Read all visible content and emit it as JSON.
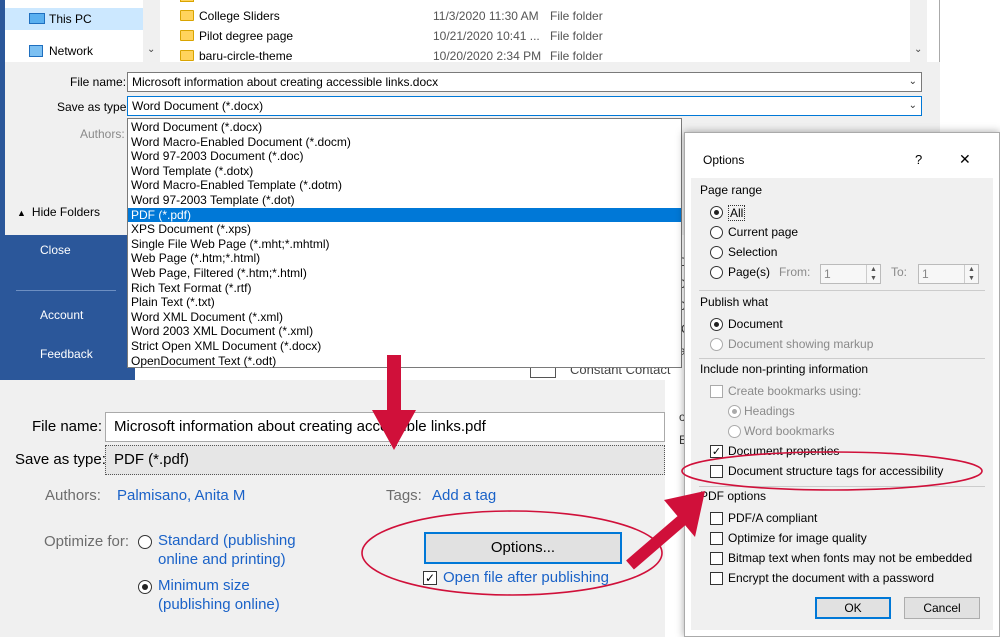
{
  "colors": {
    "brand_blue": "#2b579a",
    "selection_blue": "#0078d7",
    "link_blue": "#1a62c8",
    "annotation_red": "#d0103a"
  },
  "nav": [
    {
      "label": "This PC",
      "icon": "computer-icon"
    },
    {
      "label": "Network",
      "icon": "network-icon"
    }
  ],
  "files": [
    {
      "name": "College Sliders",
      "date": "11/3/2020 11:30 AM",
      "type": "File folder"
    },
    {
      "name": "Pilot degree page",
      "date": "10/21/2020 10:41 ...",
      "type": "File folder"
    },
    {
      "name": "baru-circle-theme",
      "date": "10/20/2020 2:34 PM",
      "type": "File folder"
    }
  ],
  "save_dialog": {
    "file_name_label": "File name:",
    "file_name_value": "Microsoft information about creating accessible links.docx",
    "save_type_label": "Save as type:",
    "save_type_value": "Word Document (*.docx)",
    "authors_label": "Authors:",
    "hide_folders": "Hide Folders"
  },
  "type_options": [
    "Word Document (*.docx)",
    "Word Macro-Enabled Document (*.docm)",
    "Word 97-2003 Document (*.doc)",
    "Word Template (*.dotx)",
    "Word Macro-Enabled Template (*.dotm)",
    "Word 97-2003 Template (*.dot)",
    "PDF (*.pdf)",
    "XPS Document (*.xps)",
    "Single File Web Page (*.mht;*.mhtml)",
    "Web Page (*.htm;*.html)",
    "Web Page, Filtered (*.htm;*.html)",
    "Rich Text Format (*.rtf)",
    "Plain Text (*.txt)",
    "Word XML Document (*.xml)",
    "Word 2003 XML Document (*.xml)",
    "Strict Open XML Document (*.docx)",
    "OpenDocument Text (*.odt)"
  ],
  "selected_type_index": 6,
  "backstage": {
    "close": "Close",
    "account": "Account",
    "feedback": "Feedback"
  },
  "background_fragments": [
    "Di",
    "08",
    "02",
    "C",
    "at",
    "od",
    "EM",
    "ro",
    "fi",
    "Constant Contact"
  ],
  "pdf_panel": {
    "file_name_label": "File name:",
    "file_name_value": "Microsoft information about creating accessible links.pdf",
    "save_type_label": "Save as type:",
    "save_type_value": "PDF (*.pdf)",
    "authors_label": "Authors:",
    "authors_value": "Palmisano, Anita M",
    "tags_label": "Tags:",
    "tags_value": "Add a tag",
    "optimize_label": "Optimize for:",
    "standard_line1": "Standard (publishing",
    "standard_line2": "online and printing)",
    "minimum_line1": "Minimum size",
    "minimum_line2": "(publishing online)",
    "options_button": "Options...",
    "open_after": "Open file after publishing"
  },
  "options_dialog": {
    "title": "Options",
    "help": "?",
    "close": "✕",
    "page_range": "Page range",
    "all": "All",
    "current_page": "Current page",
    "selection": "Selection",
    "pages": "Page(s)",
    "from": "From:",
    "from_value": "1",
    "to": "To:",
    "to_value": "1",
    "publish_what": "Publish what",
    "document": "Document",
    "document_markup": "Document showing markup",
    "non_printing": "Include non-printing information",
    "create_bookmarks": "Create bookmarks using:",
    "headings": "Headings",
    "word_bookmarks": "Word bookmarks",
    "doc_properties": "Document properties",
    "structure_tags": "Document structure tags for accessibility",
    "pdf_options": "PDF options",
    "pdfa": "PDF/A compliant",
    "optimize_image": "Optimize for image quality",
    "bitmap_text": "Bitmap text when fonts may not be embedded",
    "encrypt": "Encrypt the document with a password",
    "ok": "OK",
    "cancel": "Cancel"
  }
}
